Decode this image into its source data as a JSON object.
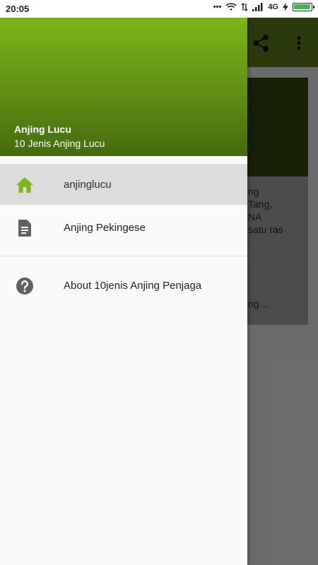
{
  "status_bar": {
    "time": "20:05",
    "network": "4G",
    "battery_level": 1.0,
    "icons": [
      "dots-icon",
      "wifi-icon",
      "data-arrows-icon",
      "signal-icon",
      "charging-icon",
      "battery-icon"
    ]
  },
  "background_app": {
    "card_text": "ng\nTang,\nNA\nsatu ras",
    "card_more": "ng…",
    "toolbar_icons": [
      "share-icon",
      "more-vert-icon"
    ]
  },
  "drawer": {
    "header": {
      "title": "Anjing Lucu",
      "subtitle": "10 Jenis Anjing Lucu"
    },
    "items": [
      {
        "label": "anjinglucu",
        "icon": "home-icon",
        "selected": true
      },
      {
        "label": "Anjing Pekingese",
        "icon": "document-icon",
        "selected": false
      },
      {
        "label": "About 10jenis Anjing Penjaga",
        "icon": "help-icon",
        "selected": false
      }
    ]
  },
  "colors": {
    "accent": "#7cb518",
    "header_dark": "#446a0e",
    "icon_gray": "#616161",
    "selected_bg": "#dcdcdc"
  }
}
